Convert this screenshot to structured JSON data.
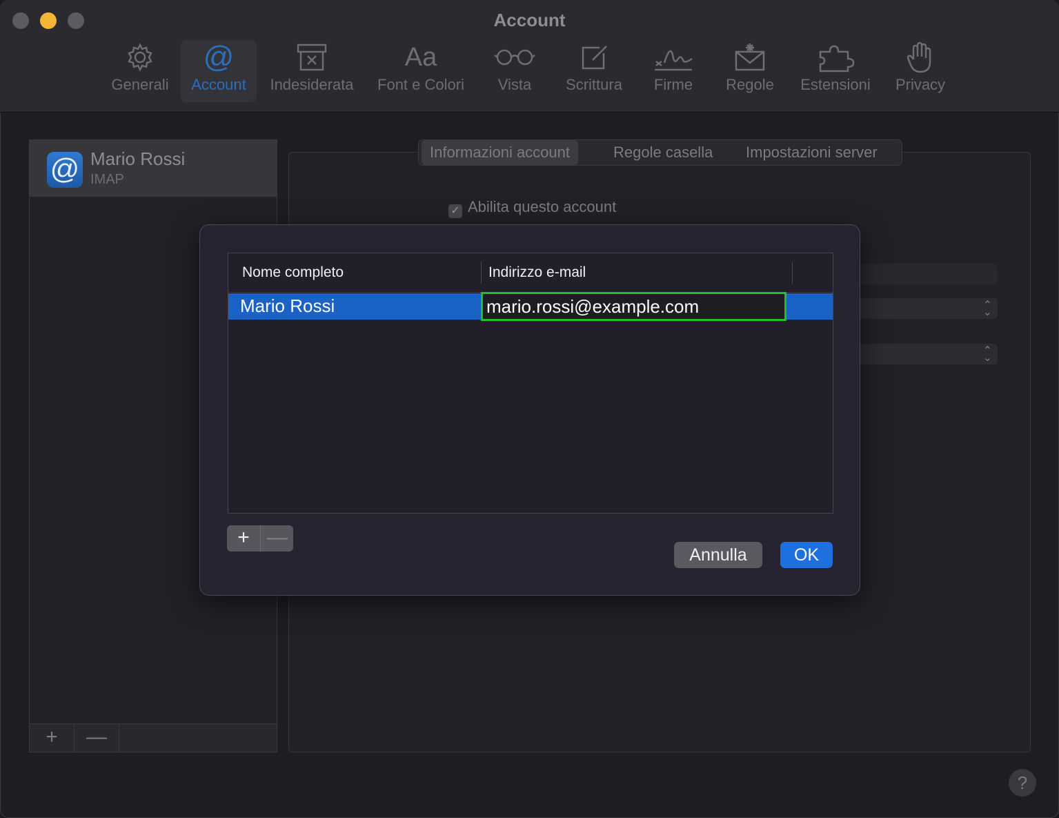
{
  "window": {
    "title": "Account"
  },
  "toolbar": {
    "items": [
      {
        "label": "Generali",
        "icon": "gear-icon"
      },
      {
        "label": "Account",
        "icon": "at-icon",
        "active": true
      },
      {
        "label": "Indesiderata",
        "icon": "junk-icon"
      },
      {
        "label": "Font e Colori",
        "icon": "font-icon",
        "glyph": "Aa"
      },
      {
        "label": "Vista",
        "icon": "glasses-icon"
      },
      {
        "label": "Scrittura",
        "icon": "compose-icon"
      },
      {
        "label": "Firme",
        "icon": "signature-icon"
      },
      {
        "label": "Regole",
        "icon": "rules-icon"
      },
      {
        "label": "Estensioni",
        "icon": "puzzle-icon"
      },
      {
        "label": "Privacy",
        "icon": "hand-icon"
      }
    ]
  },
  "accounts": {
    "items": [
      {
        "name": "Mario Rossi",
        "type": "IMAP",
        "icon_glyph": "@"
      }
    ],
    "add_label": "+",
    "remove_label": "—"
  },
  "tabs": {
    "items": [
      {
        "label": "Informazioni account",
        "active": true
      },
      {
        "label": "Regole casella"
      },
      {
        "label": "Impostazioni server"
      }
    ]
  },
  "enable_account": {
    "label": "Abilita questo account",
    "checked": true
  },
  "help_label": "?",
  "dialog": {
    "columns": [
      "Nome completo",
      "Indirizzo e-mail"
    ],
    "rows": [
      {
        "name": "Mario Rossi",
        "email": "mario.rossi@example.com"
      }
    ],
    "add_label": "+",
    "remove_label": "—",
    "cancel_label": "Annulla",
    "ok_label": "OK"
  },
  "colors": {
    "selection": "#1a62c6",
    "edit_highlight": "#22c022",
    "ok_button": "#1e6fe0"
  }
}
